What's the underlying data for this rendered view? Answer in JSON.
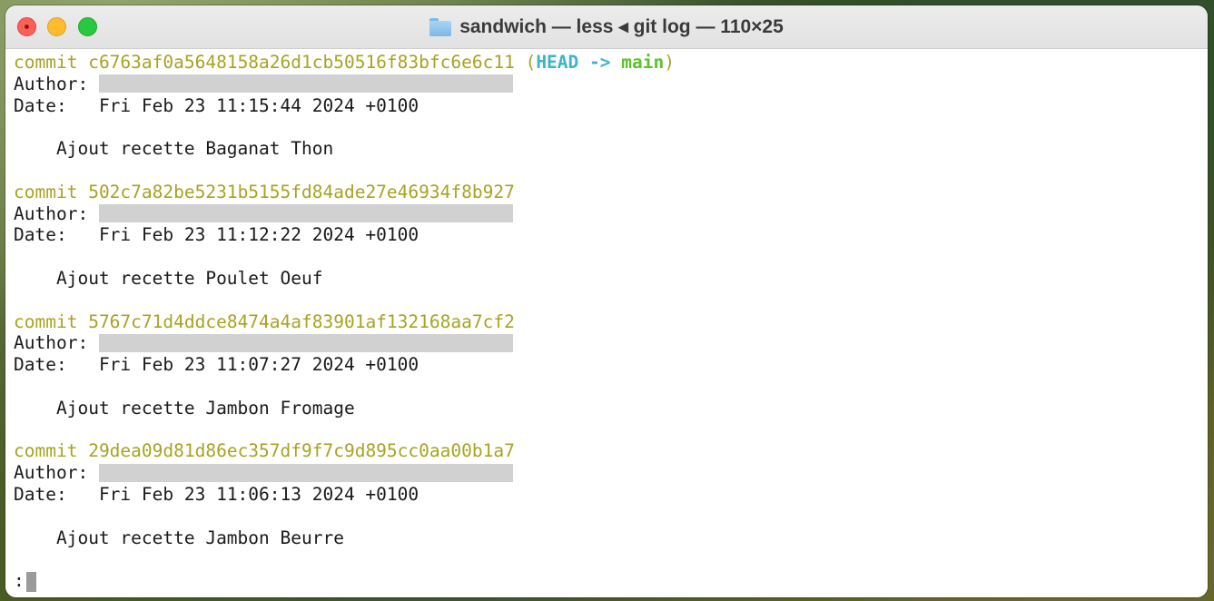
{
  "window": {
    "title": "sandwich — less ◂ git log — 110×25"
  },
  "colors": {
    "commit_hash": "#a7a321",
    "head_label": "#3ab6c6",
    "branch_label": "#5ec22c",
    "redaction": "#d1d1d1"
  },
  "commits": [
    {
      "commit_word": "commit",
      "hash": "c6763af0a5648158a26d1cb50516f83bfc6e6c11",
      "ref_open": "(",
      "ref_head": "HEAD",
      "ref_arrow": "->",
      "ref_branch": "main",
      "ref_close": ")",
      "author_label": "Author:",
      "date_label": "Date:",
      "date": "Fri Feb 23 11:15:44 2024 +0100",
      "message": "Ajout recette Baganat Thon"
    },
    {
      "commit_word": "commit",
      "hash": "502c7a82be5231b5155fd84ade27e46934f8b927",
      "author_label": "Author:",
      "date_label": "Date:",
      "date": "Fri Feb 23 11:12:22 2024 +0100",
      "message": "Ajout recette Poulet Oeuf"
    },
    {
      "commit_word": "commit",
      "hash": "5767c71d4ddce8474a4af83901af132168aa7cf2",
      "author_label": "Author:",
      "date_label": "Date:",
      "date": "Fri Feb 23 11:07:27 2024 +0100",
      "message": "Ajout recette Jambon Fromage"
    },
    {
      "commit_word": "commit",
      "hash": "29dea09d81d86ec357df9f7c9d895cc0aa00b1a7",
      "author_label": "Author:",
      "date_label": "Date:",
      "date": "Fri Feb 23 11:06:13 2024 +0100",
      "message": "Ajout recette Jambon Beurre"
    }
  ],
  "prompt": ":"
}
